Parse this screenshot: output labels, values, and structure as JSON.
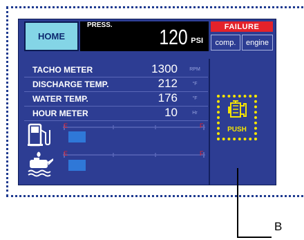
{
  "header": {
    "home_label": "HOME",
    "press_label": "PRESS.",
    "press_value": "120",
    "press_unit": "PSI"
  },
  "failure": {
    "title": "FAILURE",
    "buttons": [
      "comp.",
      "engine"
    ]
  },
  "meters": [
    {
      "label": "TACHO METER",
      "value": "1300",
      "unit": "RPM"
    },
    {
      "label": "DISCHARGE TEMP.",
      "value": "212",
      "unit": "°F"
    },
    {
      "label": "WATER TEMP.",
      "value": "176",
      "unit": "°F"
    },
    {
      "label": "HOUR METER",
      "value": "10",
      "unit": "Hr"
    }
  ],
  "gauges": [
    {
      "name": "fuel-level-gauge",
      "icon": "fuel-pump-icon",
      "empty_mark": "E",
      "full_mark": "F",
      "level": 0.13
    },
    {
      "name": "oil-level-gauge",
      "icon": "oil-can-icon",
      "empty_mark": "E",
      "full_mark": "F",
      "level": 0.13
    }
  ],
  "push_button": {
    "icon": "engine-warning-icon",
    "label": "PUSH"
  },
  "callout": {
    "label": "B"
  },
  "colors": {
    "panel": "#2d3d93",
    "home": "#84d5e6",
    "failure": "#e4222a",
    "highlight": "#f5e400",
    "gauge_marks": "#e4222a"
  }
}
